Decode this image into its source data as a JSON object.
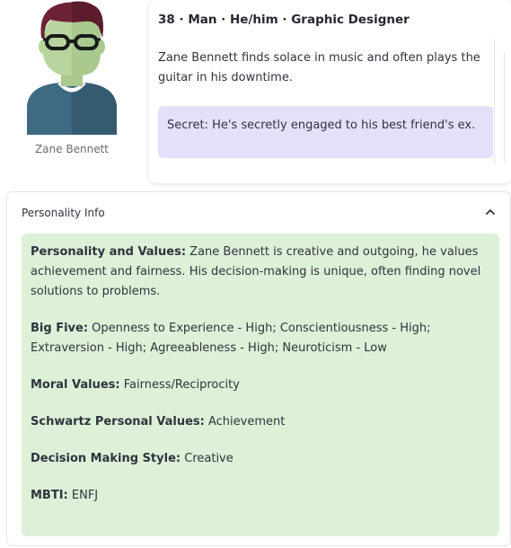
{
  "avatar": {
    "name": "Zane Bennett",
    "colors": {
      "hair": "#6d2336",
      "skin": "#b7d59d",
      "shirt": "#3e6a83",
      "glasses": "#1a1a1a",
      "collar": "#ffffff"
    }
  },
  "profile": {
    "header": "38 · Man · He/him · Graphic Designer",
    "bio": "Zane Bennett finds solace in music and often plays the guitar in his downtime.",
    "secret": "Secret: He's secretly engaged to his best friend's ex."
  },
  "personality": {
    "title": "Personality Info",
    "items": [
      {
        "label": "Personality and Values:",
        "value": " Zane Bennett is creative and outgoing, he values achievement and fairness. His decision-making is unique, often finding novel solutions to problems."
      },
      {
        "label": "Big Five:",
        "value": " Openness to Experience - High; Conscientiousness - High; Extraversion - High; Agreeableness - High; Neuroticism - Low"
      },
      {
        "label": "Moral Values:",
        "value": " Fairness/Reciprocity"
      },
      {
        "label": "Schwartz Personal Values:",
        "value": " Achievement"
      },
      {
        "label": "Decision Making Style:",
        "value": " Creative"
      },
      {
        "label": "MBTI:",
        "value": " ENFJ"
      }
    ]
  },
  "colors": {
    "secret_bg": "#e3e0fa",
    "info_bg": "#dcf1d7"
  },
  "icons": {
    "collapse": "chevron-up-icon"
  }
}
